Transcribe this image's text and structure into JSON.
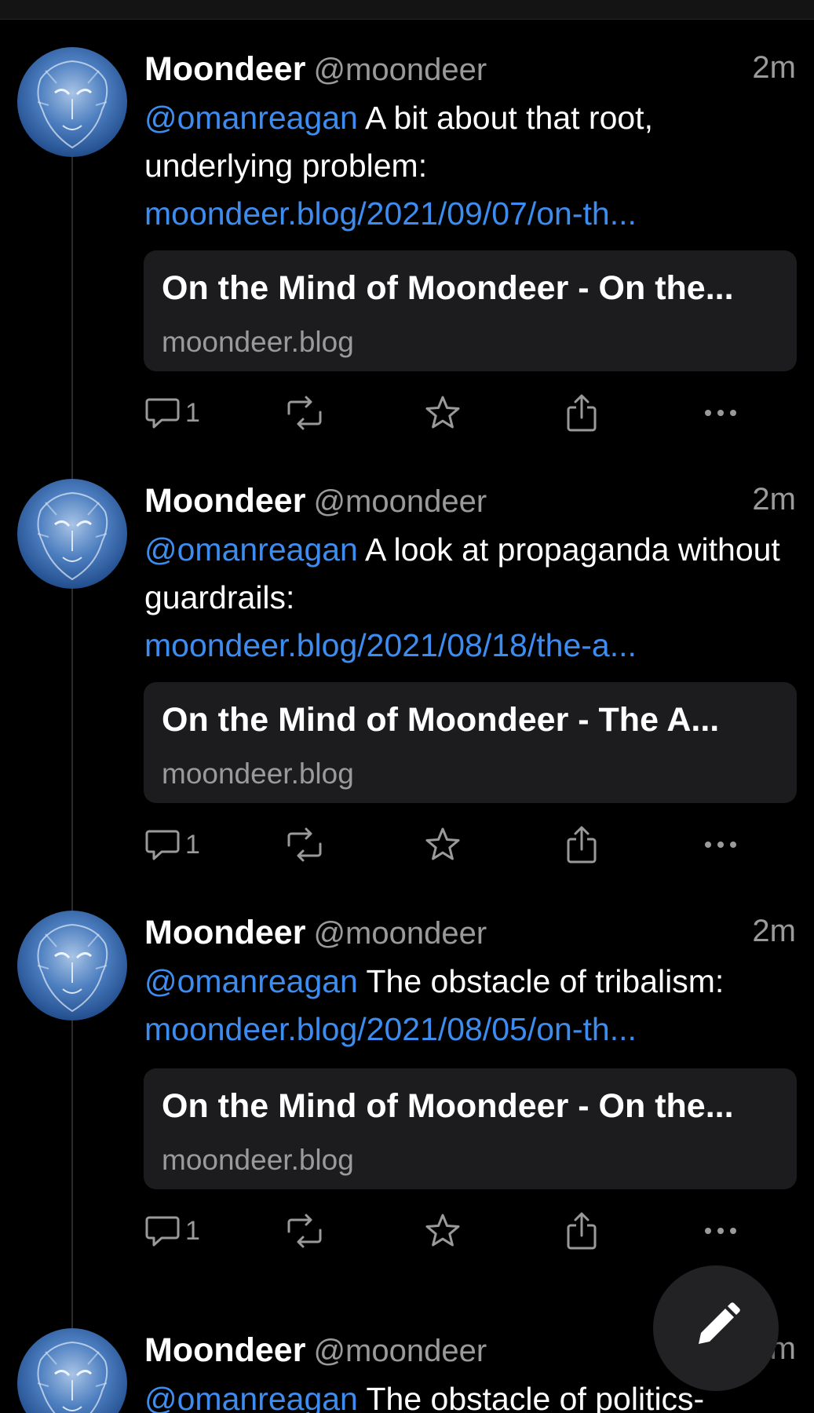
{
  "posts": [
    {
      "author_name": "Moondeer",
      "author_handle": "@moondeer",
      "time": "2m",
      "mention": "@omanreagan",
      "text": " A bit about that root, underlying problem:",
      "link": "moondeer.blog/2021/09/07/on-th...",
      "card_title": "On the Mind of Moondeer - On the...",
      "card_domain": "moondeer.blog",
      "reply_count": "1"
    },
    {
      "author_name": "Moondeer",
      "author_handle": "@moondeer",
      "time": "2m",
      "mention": "@omanreagan",
      "text": " A look at propaganda without guardrails:",
      "link": "moondeer.blog/2021/08/18/the-a...",
      "card_title": "On the Mind of Moondeer - The A...",
      "card_domain": "moondeer.blog",
      "reply_count": "1"
    },
    {
      "author_name": "Moondeer",
      "author_handle": "@moondeer",
      "time": "2m",
      "mention": "@omanreagan",
      "text": " The obstacle of tribalism:",
      "link": "moondeer.blog/2021/08/05/on-th...",
      "card_title": "On the Mind of Moondeer - On the...",
      "card_domain": "moondeer.blog",
      "reply_count": "1"
    },
    {
      "author_name": "Moondeer",
      "author_handle": "@moondeer",
      "time": "2m",
      "mention": "@omanreagan",
      "text": " The obstacle of politics-"
    }
  ],
  "icons": {
    "reply": "speech-bubble-icon",
    "boost": "repeat-arrows-icon",
    "favourite": "star-icon",
    "share": "share-icon",
    "more": "ellipsis-icon",
    "compose": "pencil-icon"
  },
  "colors": {
    "background": "#000000",
    "link": "#3d8cf0",
    "card": "#1c1c1e",
    "muted": "#9a9a9a"
  }
}
